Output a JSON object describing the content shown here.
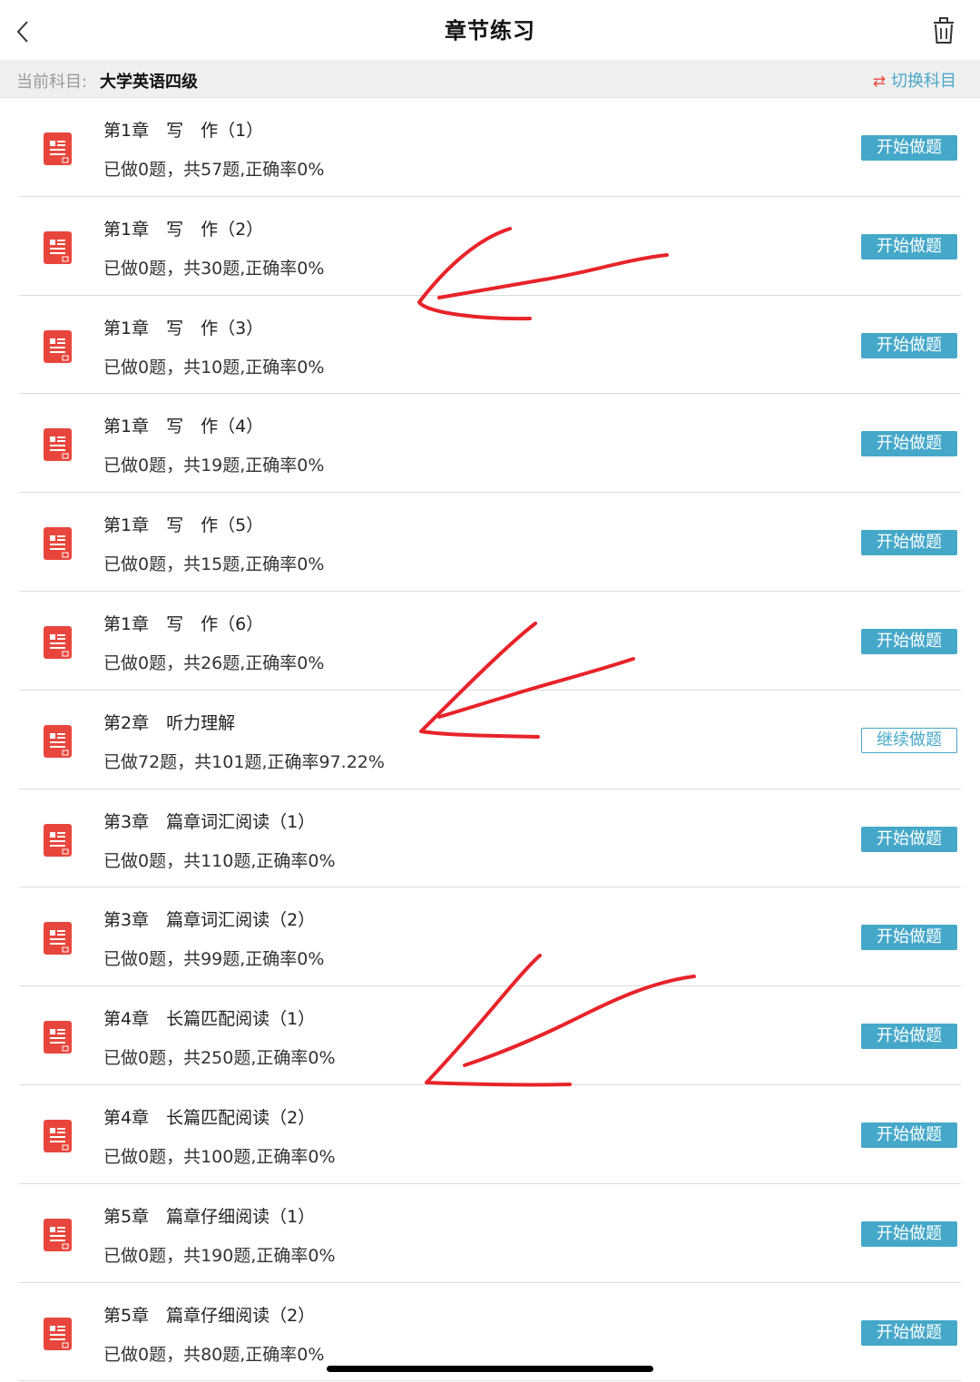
{
  "header": {
    "title": "章节练习",
    "back_icon": "chevron-left-icon",
    "trash_icon": "trash-icon"
  },
  "subject_bar": {
    "label": "当前科目:",
    "value": "大学英语四级",
    "switch_label": "切换科目",
    "switch_icon": "⇄"
  },
  "colors": {
    "accent": "#45a8c9",
    "icon_red": "#e8463c",
    "annotation_red": "#e8232a"
  },
  "chapters": [
    {
      "title": "第1章　写　作（1）",
      "stats": "已做0题，共57题,正确率0%",
      "button": "开始做题"
    },
    {
      "title": "第1章　写　作（2）",
      "stats": "已做0题，共30题,正确率0%",
      "button": "开始做题"
    },
    {
      "title": "第1章　写　作（3）",
      "stats": "已做0题，共10题,正确率0%",
      "button": "开始做题"
    },
    {
      "title": "第1章　写　作（4）",
      "stats": "已做0题，共19题,正确率0%",
      "button": "开始做题"
    },
    {
      "title": "第1章　写　作（5）",
      "stats": "已做0题，共15题,正确率0%",
      "button": "开始做题"
    },
    {
      "title": "第1章　写　作（6）",
      "stats": "已做0题，共26题,正确率0%",
      "button": "开始做题"
    },
    {
      "title": "第2章　听力理解",
      "stats": "已做72题，共101题,正确率97.22%",
      "button": "继续做题"
    },
    {
      "title": "第3章　篇章词汇阅读（1）",
      "stats": "已做0题，共110题,正确率0%",
      "button": "开始做题"
    },
    {
      "title": "第3章　篇章词汇阅读（2）",
      "stats": "已做0题，共99题,正确率0%",
      "button": "开始做题"
    },
    {
      "title": "第4章　长篇匹配阅读（1）",
      "stats": "已做0题，共250题,正确率0%",
      "button": "开始做题"
    },
    {
      "title": "第4章　长篇匹配阅读（2）",
      "stats": "已做0题，共100题,正确率0%",
      "button": "开始做题"
    },
    {
      "title": "第5章　篇章仔细阅读（1）",
      "stats": "已做0题，共190题,正确率0%",
      "button": "开始做题"
    },
    {
      "title": "第5章　篇章仔细阅读（2）",
      "stats": "已做0题，共80题,正确率0%",
      "button": "开始做题"
    }
  ]
}
